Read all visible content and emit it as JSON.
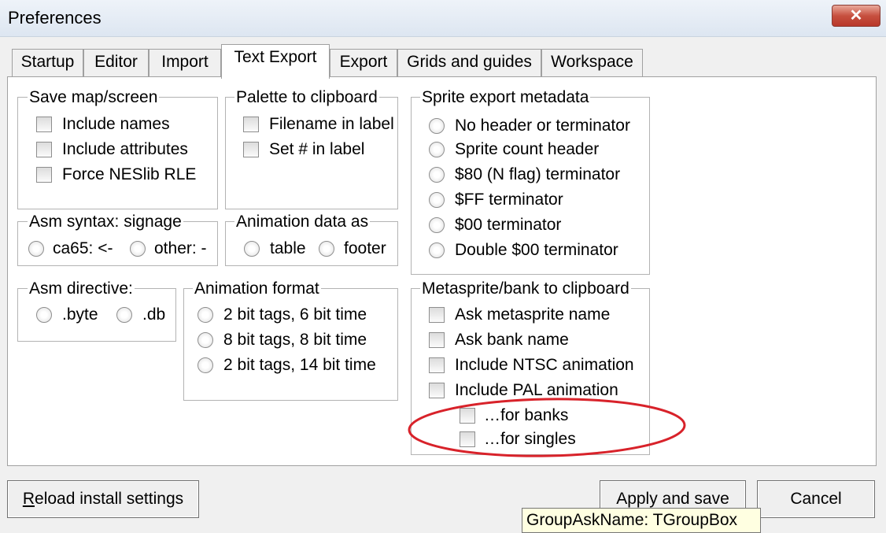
{
  "window": {
    "title": "Preferences",
    "close_glyph": "✕"
  },
  "tabs": [
    "Startup",
    "Editor",
    "Import",
    "Text Export",
    "Export",
    "Grids and guides",
    "Workspace"
  ],
  "active_tab": "Text Export",
  "groups": {
    "save_map": {
      "label": "Save map/screen",
      "options": [
        "Include names",
        "Include attributes",
        "Force NESlib RLE"
      ]
    },
    "palette": {
      "label": "Palette to clipboard",
      "options": [
        "Filename in label",
        "Set # in label"
      ]
    },
    "sprite_meta": {
      "label": "Sprite export metadata",
      "options": [
        "No header or terminator",
        "Sprite count header",
        "$80 (N flag) terminator",
        "$FF terminator",
        "$00 terminator",
        "Double $00 terminator"
      ]
    },
    "asm_syntax": {
      "label": "Asm syntax: signage",
      "options": [
        "ca65: <-",
        "other: -"
      ]
    },
    "anim_data": {
      "label": "Animation data as",
      "options": [
        "table",
        "footer"
      ]
    },
    "asm_directive": {
      "label": "Asm directive:",
      "options": [
        ".byte",
        ".db"
      ]
    },
    "anim_format": {
      "label": "Animation format",
      "options": [
        "2 bit tags, 6 bit time",
        "8 bit tags, 8 bit time",
        "2 bit tags, 14 bit time"
      ]
    },
    "metasprite": {
      "label": "Metasprite/bank to clipboard",
      "options": [
        "Ask metasprite name",
        "Ask bank name",
        "Include NTSC animation",
        "Include PAL animation"
      ],
      "sub_options": [
        "…for banks",
        "…for singles"
      ]
    }
  },
  "buttons": {
    "reload": {
      "accel": "R",
      "rest": "eload install settings"
    },
    "apply": "Apply and save",
    "cancel": "Cancel"
  },
  "tooltip": "GroupAskName: TGroupBox",
  "colors": {
    "annotation_ring": "#d8222a",
    "close_button": "#c7503f",
    "tooltip_bg": "#ffffe1"
  }
}
